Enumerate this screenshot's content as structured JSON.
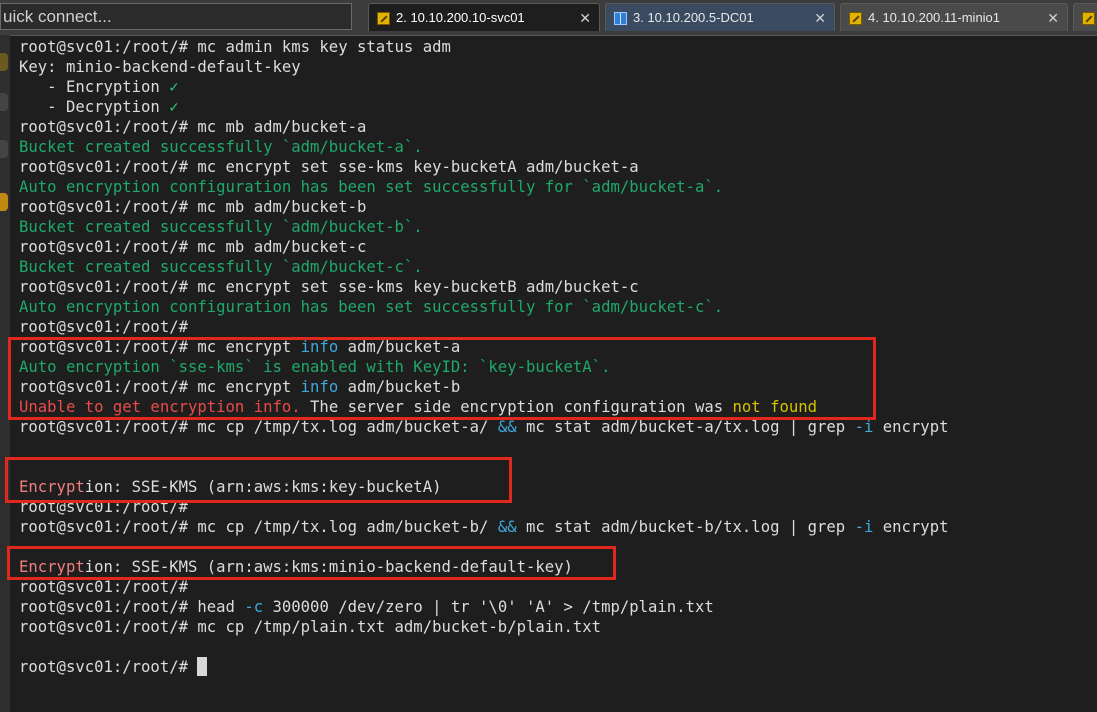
{
  "app": {
    "quick_connect_placeholder": "uick connect..."
  },
  "tabs": [
    {
      "label": "2. 10.10.200.10-svc01",
      "icon": "key-icon",
      "active": true,
      "close": "✕"
    },
    {
      "label": "3. 10.10.200.5-DC01",
      "icon": "windows-icon",
      "active": false,
      "close": "✕"
    },
    {
      "label": "4. 10.10.200.11-minio1",
      "icon": "key-icon",
      "active": false,
      "close": "✕"
    }
  ],
  "colors": {
    "success_green": "#1fa86a",
    "keyword_blue": "#3fa9dc",
    "error_red": "#ec4a4a",
    "highlight_box": "#e0281c"
  },
  "terminal": {
    "lines": [
      {
        "segs": [
          [
            "w",
            "root@svc01:/root/# mc admin kms key status adm"
          ]
        ]
      },
      {
        "segs": [
          [
            "w",
            "Key: minio-backend-default-key"
          ]
        ]
      },
      {
        "segs": [
          [
            "w",
            "   - Encryption "
          ],
          [
            "ok",
            "✓"
          ]
        ]
      },
      {
        "segs": [
          [
            "w",
            "   - Decryption "
          ],
          [
            "ok",
            "✓"
          ]
        ]
      },
      {
        "segs": [
          [
            "w",
            "root@svc01:/root/# mc mb adm/bucket-a"
          ]
        ]
      },
      {
        "segs": [
          [
            "g",
            "Bucket created successfully `adm/bucket-a`."
          ]
        ]
      },
      {
        "segs": [
          [
            "w",
            "root@svc01:/root/# mc encrypt set sse-kms key-bucketA adm/bucket-a"
          ]
        ]
      },
      {
        "segs": [
          [
            "g",
            "Auto encryption configuration has been set successfully for `adm/bucket-a`."
          ]
        ]
      },
      {
        "segs": [
          [
            "w",
            "root@svc01:/root/# mc mb adm/bucket-b"
          ]
        ]
      },
      {
        "segs": [
          [
            "g",
            "Bucket created successfully `adm/bucket-b`."
          ]
        ]
      },
      {
        "segs": [
          [
            "w",
            "root@svc01:/root/# mc mb adm/bucket-c"
          ]
        ]
      },
      {
        "segs": [
          [
            "g",
            "Bucket created successfully `adm/bucket-c`."
          ]
        ]
      },
      {
        "segs": [
          [
            "w",
            "root@svc01:/root/# mc encrypt set sse-kms key-bucketB adm/bucket-c"
          ]
        ]
      },
      {
        "segs": [
          [
            "g",
            "Auto encryption configuration has been set successfully for `adm/bucket-c`."
          ]
        ]
      },
      {
        "segs": [
          [
            "w",
            "root@svc01:/root/#"
          ]
        ]
      },
      {
        "segs": [
          [
            "w",
            "root@svc01:/root/# mc encrypt "
          ],
          [
            "b",
            "info"
          ],
          [
            "w",
            " adm/bucket-a"
          ]
        ]
      },
      {
        "segs": [
          [
            "g",
            "Auto encryption `sse-kms` is enabled with KeyID: `key-bucketA`."
          ]
        ]
      },
      {
        "segs": [
          [
            "w",
            "root@svc01:/root/# mc encrypt "
          ],
          [
            "b",
            "info"
          ],
          [
            "w",
            " adm/bucket-b"
          ]
        ]
      },
      {
        "segs": [
          [
            "r",
            "Unable to get encryption info."
          ],
          [
            "w",
            " The server side encryption configuration was "
          ],
          [
            "y",
            "not found"
          ]
        ]
      },
      {
        "segs": [
          [
            "w",
            "root@svc01:/root/# mc cp /tmp/tx.log adm/bucket-a/ "
          ],
          [
            "b",
            "&&"
          ],
          [
            "w",
            " mc stat adm/bucket-a/tx.log | grep "
          ],
          [
            "b",
            "-i"
          ],
          [
            "w",
            " encrypt"
          ]
        ]
      },
      {
        "segs": []
      },
      {
        "segs": []
      },
      {
        "segs": [
          [
            "p",
            "Encrypt"
          ],
          [
            "w",
            "ion: SSE-KMS (arn:aws:kms:key-bucketA)"
          ]
        ]
      },
      {
        "segs": [
          [
            "w",
            "root@svc01:/root/#"
          ]
        ]
      },
      {
        "segs": [
          [
            "w",
            "root@svc01:/root/# mc cp /tmp/tx.log adm/bucket-b/ "
          ],
          [
            "b",
            "&&"
          ],
          [
            "w",
            " mc stat adm/bucket-b/tx.log | grep "
          ],
          [
            "b",
            "-i"
          ],
          [
            "w",
            " encrypt"
          ]
        ]
      },
      {
        "segs": []
      },
      {
        "segs": [
          [
            "p",
            "Encrypt"
          ],
          [
            "w",
            "ion: SSE-KMS (arn:aws:kms:minio-backend-default-key)"
          ]
        ]
      },
      {
        "segs": [
          [
            "w",
            "root@svc01:/root/#"
          ]
        ]
      },
      {
        "segs": [
          [
            "w",
            "root@svc01:/root/# head "
          ],
          [
            "b",
            "-c"
          ],
          [
            "w",
            " 300000 /dev/zero | tr '\\0' 'A' > /tmp/plain.txt"
          ]
        ]
      },
      {
        "segs": [
          [
            "w",
            "root@svc01:/root/# mc cp /tmp/plain.txt adm/bucket-b/plain.txt"
          ]
        ]
      },
      {
        "segs": []
      },
      {
        "segs": [
          [
            "w",
            "root@svc01:/root/# "
          ]
        ],
        "cursor": true
      }
    ]
  }
}
